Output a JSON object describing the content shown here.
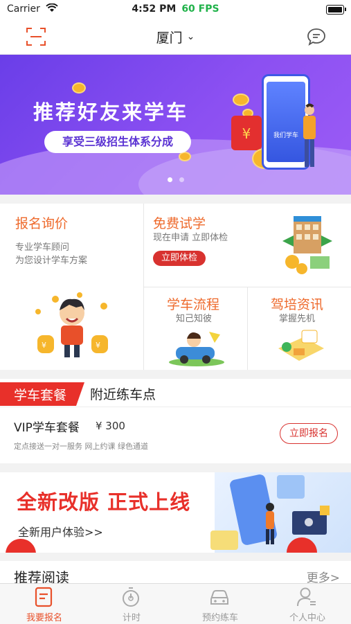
{
  "status_bar": {
    "carrier": "Carrier",
    "time": "4:52 PM",
    "fps": "60 FPS"
  },
  "nav": {
    "city": "厦门",
    "city_chevron": "⌄"
  },
  "banner": {
    "headline": "推荐好友来学车",
    "tagline": "享受三级招生体系分成",
    "phone_text": "我们学车",
    "currency": "¥",
    "page_count": 2,
    "active_page": 1
  },
  "grid": {
    "signup_inquiry": {
      "title": "报名询价",
      "lines": [
        "专业学车顾问",
        "为您设计学车方案"
      ]
    },
    "free_trial": {
      "title": "免费试学",
      "sub": "现在申请 立即体检",
      "button": "立即体检"
    },
    "process": {
      "title": "学车流程",
      "sub": "知己知彼"
    },
    "news": {
      "title": "驾培资讯",
      "sub": "掌握先机"
    }
  },
  "packages": {
    "tabs": [
      "学车套餐",
      "附近练车点"
    ],
    "item": {
      "name": "VIP学车套餐",
      "price": "¥ 300",
      "features": "定点接送一对一服务  网上约课  绿色通道",
      "button": "立即报名"
    }
  },
  "promo": {
    "headline": "全新改版 正式上线",
    "sub": "全新用户体验>>"
  },
  "recommended": {
    "title": "推荐阅读",
    "more": "更多>"
  },
  "tabbar": [
    {
      "label": "我要报名",
      "icon": "signup-icon",
      "active": true
    },
    {
      "label": "计时",
      "icon": "timer-icon",
      "active": false
    },
    {
      "label": "预约练车",
      "icon": "car-icon",
      "active": false
    },
    {
      "label": "个人中心",
      "icon": "profile-icon",
      "active": false
    }
  ],
  "colors": {
    "accent": "#e8502a",
    "red": "#d8322f",
    "banner_purple": "#7c46ee"
  }
}
